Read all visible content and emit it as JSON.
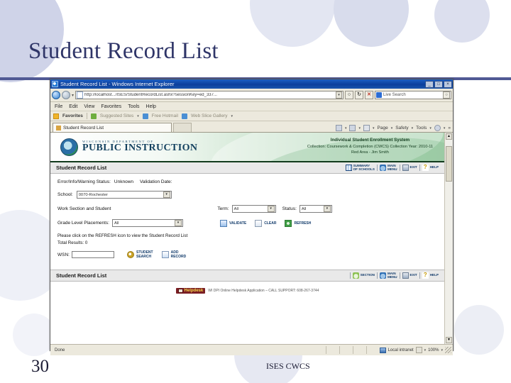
{
  "slide": {
    "title": "Student Record List",
    "number": "30",
    "footer": "ISES CWCS"
  },
  "browser": {
    "title": "Student Record List - Windows Internet Explorer",
    "window_buttons": {
      "minimize": "_",
      "maximize": "□",
      "close": "×"
    },
    "address": {
      "url": "http://localhost.../ISES/StudentRecordList.ashx?sessionKey=ed_337...",
      "dropdown_icon": "▾",
      "refresh_icon": "↻",
      "search_icon": "○",
      "stop_icon": "✕"
    },
    "search": {
      "placeholder": "Live Search",
      "provider_icon": "live-search-icon",
      "go_icon": "○"
    },
    "menu": [
      "File",
      "Edit",
      "View",
      "Favorites",
      "Tools",
      "Help"
    ],
    "favorites_bar": {
      "favorites_label": "Favorites",
      "items": [
        "Suggested Sites",
        "Free Hotmail",
        "Web Slice Gallery"
      ],
      "caret": "▾"
    },
    "tab": {
      "label": "Student Record List"
    },
    "command_bar": {
      "items": [
        "Page",
        "Safety",
        "Tools"
      ],
      "caret": "▾",
      "overflow": "»",
      "help_icon": "?"
    }
  },
  "banner": {
    "agency_sub": "WISCONSIN DEPARTMENT OF",
    "agency_main": "PUBLIC INSTRUCTION",
    "system": "Individual Student Enrollment System",
    "collection": "Collection: Coursework & Completion (CWCS)     Collection Year: 2010-11",
    "user": "Red Area - Jim Smith"
  },
  "header_bar": {
    "title": "Student Record List",
    "actions": [
      {
        "label_line1": "SUMMARY",
        "label_line2": "OF SCHOOLS",
        "icon": "grid-icon"
      },
      {
        "label_line1": "MAIN",
        "label_line2": "MENU",
        "icon": "home-icon"
      },
      {
        "label_line1": "EXIT",
        "label_line2": "",
        "icon": "exit-icon"
      },
      {
        "label_line1": "HELP",
        "label_line2": "",
        "icon": "help-icon"
      }
    ]
  },
  "footer_bar": {
    "title": "Student Record List",
    "actions": [
      {
        "label_line1": "SECTION",
        "label_line2": "",
        "icon": "section-icon"
      },
      {
        "label_line1": "MAIN",
        "label_line2": "MENU",
        "icon": "home-icon"
      },
      {
        "label_line1": "EXIT",
        "label_line2": "",
        "icon": "exit-icon"
      },
      {
        "label_line1": "HELP",
        "label_line2": "",
        "icon": "help-icon"
      }
    ]
  },
  "form": {
    "status_line": "Error/Info/Warning Status:",
    "status_value": "Unknown",
    "validation_label": "Validation Date:",
    "validation_value": "",
    "school_label": "School:",
    "school_value": "0070-Rochester",
    "work_section_label": "Work Section and Student",
    "term_label": "Term:",
    "term_value": "All",
    "status_label": "Status:",
    "status_select_value": "All",
    "grade_label": "Grade Level Placements:",
    "grade_value": "All",
    "buttons": [
      {
        "label": "VALIDATE",
        "icon": "validate-icon"
      },
      {
        "label": "CLEAR",
        "icon": "clear-icon"
      },
      {
        "label": "REFRESH",
        "icon": "refresh-icon"
      }
    ],
    "instruction": "Please click on the REFRESH icon to view the Student Record List",
    "total_results": "Total Results: 0",
    "wsn_label": "WSN:",
    "wsn_value": "",
    "wsn_buttons": [
      {
        "label_line1": "STUDENT",
        "label_line2": "SEARCH",
        "icon": "magnifier-icon"
      },
      {
        "label_line1": "ADD",
        "label_line2": "RECORD",
        "icon": "add-record-icon"
      }
    ]
  },
  "helpdesk": {
    "badge": "Helpdesk",
    "text": "WI DPI Online Helpdesk Application – CALL SUPPORT: 608-267-3744"
  },
  "statusbar": {
    "text": "Done",
    "zone": "Local intranet",
    "zoom": "100%",
    "caret": "▾"
  },
  "colors": {
    "slide_title": "#2f3568",
    "rule": "#515a94",
    "banner_green": "#a8d2af",
    "action_blue": "#123b6b"
  }
}
